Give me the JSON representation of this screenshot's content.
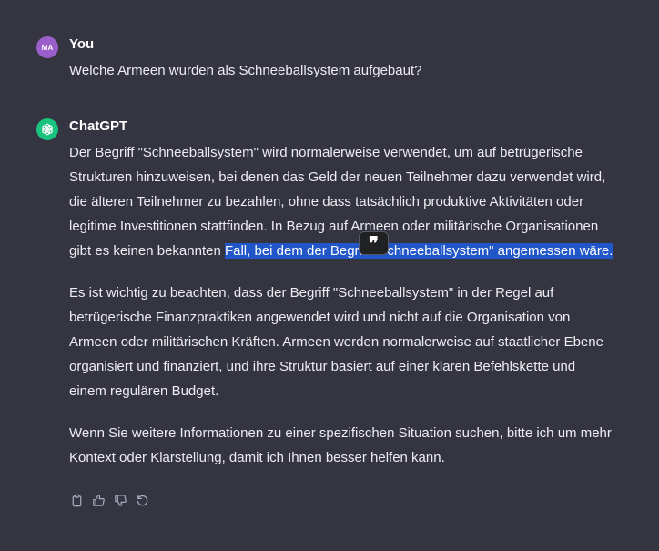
{
  "user_message": {
    "avatar_initials": "MA",
    "author": "You",
    "text": "Welche Armeen wurden als Schneeballsystem aufgebaut?"
  },
  "assistant_message": {
    "author": "ChatGPT",
    "paragraph1_part1": "Der Begriff \"Schneeballsystem\" wird normalerweise verwendet, um auf betrügerische Strukturen hinzuweisen, bei denen das Geld der neuen Teilnehmer dazu verwendet wird, die älteren Teilnehmer zu bezahlen, ohne dass tatsächlich produktive Aktivitäten oder legitime Investitionen stattfinden. In Bezug auf Armeen oder militärische Organisationen gibt es keinen bekannten ",
    "paragraph1_highlight": "Fall, bei dem der Begriff \"Schneeballsystem\" angemessen wäre.",
    "paragraph2": "Es ist wichtig zu beachten, dass der Begriff \"Schneeballsystem\" in der Regel auf betrügerische Finanzpraktiken angewendet wird und nicht auf die Organisation von Armeen oder militärischen Kräften. Armeen werden normalerweise auf staatlicher Ebene organisiert und finanziert, und ihre Struktur basiert auf einer klaren Befehlskette und einem regulären Budget.",
    "paragraph3": "Wenn Sie weitere Informationen zu einer spezifischen Situation suchen, bitte ich um mehr Kontext oder Klarstellung, damit ich Ihnen besser helfen kann.",
    "quote_button_glyph": "❞"
  },
  "actions": [
    "copy-icon",
    "thumbs-up-icon",
    "thumbs-down-icon",
    "regenerate-icon"
  ],
  "colors": {
    "background": "#343541",
    "highlight": "#2156c9",
    "user_avatar": "#9b5fc9",
    "bot_avatar": "#19c37d"
  }
}
